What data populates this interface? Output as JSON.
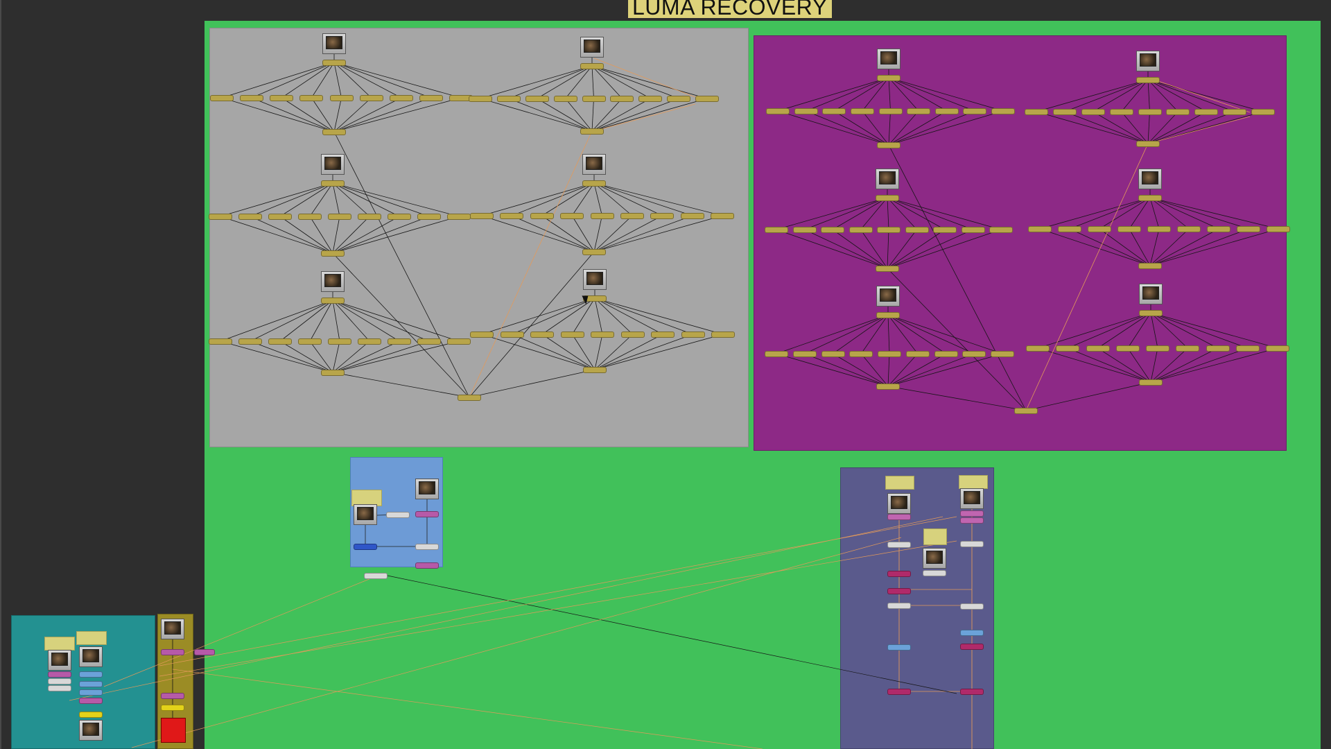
{
  "graph": {
    "title": "LUMA RECOVERY"
  },
  "colors": {
    "canvas_bg": "#2e2e2e",
    "main_backdrop": "#41c15a",
    "gray_backdrop": "#a6a6a6",
    "purple_backdrop": "#8d2986",
    "blue_backdrop": "#6d9bd6",
    "slate_backdrop": "#5a5a8c",
    "teal_backdrop": "#239191",
    "olive_backdrop": "#9b8c25",
    "merge_node": "#b8a54a",
    "edge_black": "#151515",
    "edge_orange": "#e39a5a",
    "title_bg": "#ddd27a"
  },
  "icons": [
    "read-node-thumbnail-icon",
    "mouse-cursor-icon"
  ]
}
